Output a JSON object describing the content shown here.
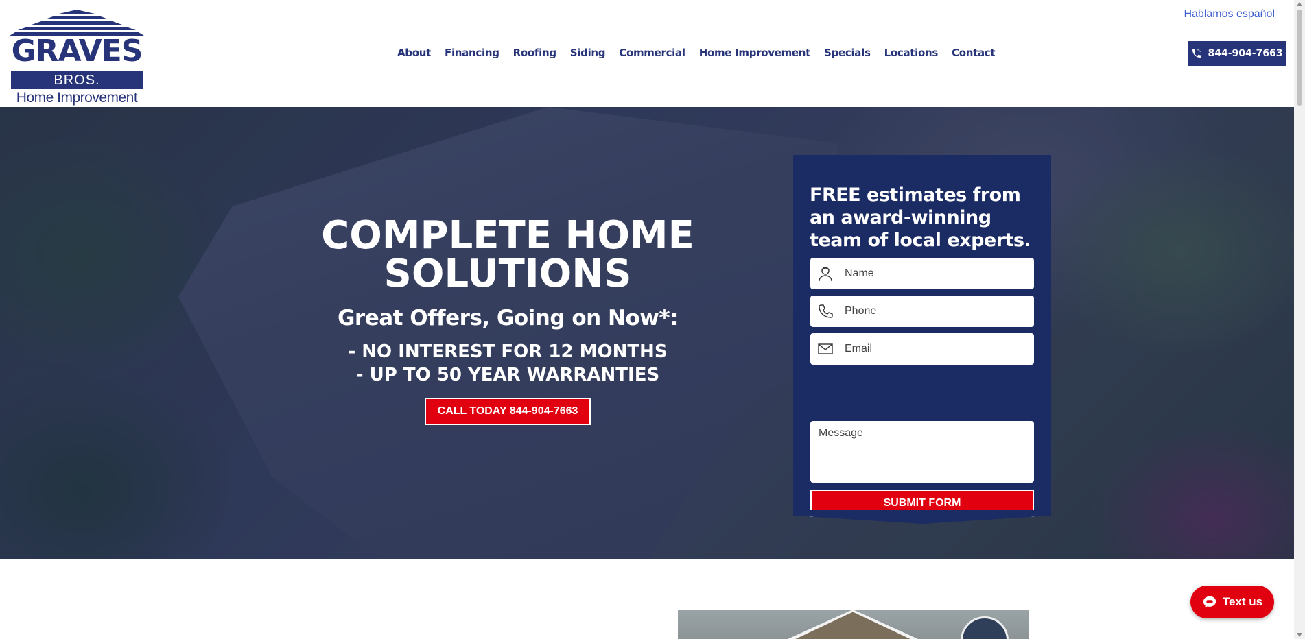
{
  "logo": {
    "name": "GRAVES",
    "sub": "BROS.",
    "tagline": "Home Improvement"
  },
  "nav": {
    "items": [
      "About",
      "Financing",
      "Roofing",
      "Siding",
      "Commercial",
      "Home Improvement",
      "Specials",
      "Locations",
      "Contact"
    ]
  },
  "header": {
    "language_link": "Hablamos español",
    "phone": "844-904-7663"
  },
  "hero": {
    "title_line1": "COMPLETE HOME",
    "title_line2": "SOLUTIONS",
    "subtitle": "Great Offers, Going on Now*:",
    "offers": [
      "- NO INTEREST FOR 12 MONTHS",
      "- UP TO 50 YEAR WARRANTIES"
    ],
    "cta_label": "CALL TODAY 844-904-7663"
  },
  "form": {
    "title": "FREE estimates from an award-winning team of local experts.",
    "name_placeholder": "Name",
    "phone_placeholder": "Phone",
    "email_placeholder": "Email",
    "message_placeholder": "Message",
    "submit_label": "SUBMIT FORM"
  },
  "chat": {
    "label": "Text us"
  },
  "colors": {
    "brand_navy": "#27347a",
    "form_navy": "#1b2b63",
    "cta_red": "#e0000f",
    "link_blue": "#3f5fd0"
  },
  "icons": [
    "phone-icon",
    "person-icon",
    "phone-icon",
    "envelope-icon",
    "chat-bubble-icon"
  ]
}
